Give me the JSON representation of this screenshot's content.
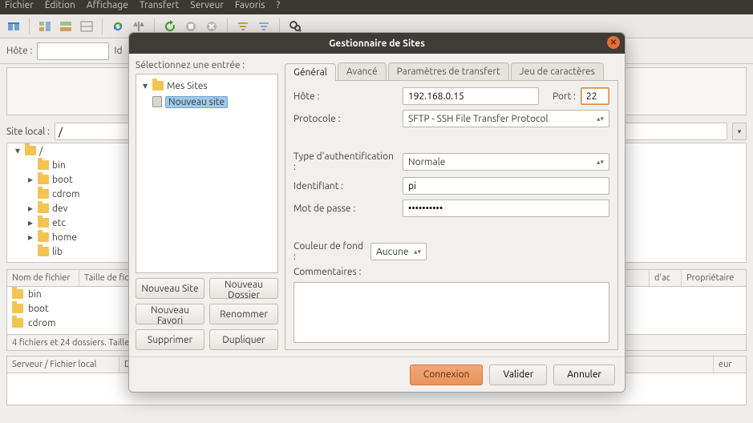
{
  "menubar": [
    "Fichier",
    "Édition",
    "Affichage",
    "Transfert",
    "Serveur",
    "Favoris",
    "?"
  ],
  "quick": {
    "host_label": "Hôte :",
    "user_label": "Id"
  },
  "local": {
    "label": "Site local :",
    "path": "/",
    "tree": [
      {
        "name": "/",
        "depth": 0,
        "expander": "▾"
      },
      {
        "name": "bin",
        "depth": 1,
        "expander": ""
      },
      {
        "name": "boot",
        "depth": 1,
        "expander": "▸"
      },
      {
        "name": "cdrom",
        "depth": 1,
        "expander": ""
      },
      {
        "name": "dev",
        "depth": 1,
        "expander": "▸"
      },
      {
        "name": "etc",
        "depth": 1,
        "expander": "▸"
      },
      {
        "name": "home",
        "depth": 1,
        "expander": "▸"
      },
      {
        "name": "lib",
        "depth": 1,
        "expander": ""
      }
    ],
    "list_cols": {
      "name": "Nom de fichier",
      "size": "Taille de fic",
      "date": "d'ac",
      "owner": "Propriétaire"
    },
    "list_rows": [
      "bin",
      "boot",
      "cdrom"
    ],
    "status": "4 fichiers et 24 dossiers. Taille"
  },
  "queue": {
    "server": "Serveur / Fichier local",
    "dir": "D",
    "remote": "eur"
  },
  "dialog": {
    "title": "Gestionnaire de Sites",
    "select_caption": "Sélectionnez une entrée :",
    "tree": {
      "root": "Mes Sites",
      "entry": "Nouveau site"
    },
    "buttons": {
      "new_site": "Nouveau Site",
      "new_folder": "Nouveau Dossier",
      "new_favorite": "Nouveau Favori",
      "rename": "Renommer",
      "delete": "Supprimer",
      "duplicate": "Dupliquer"
    },
    "tabs": [
      "Général",
      "Avancé",
      "Paramètres de transfert",
      "Jeu de caractères"
    ],
    "form": {
      "host_label": "Hôte :",
      "host": "192.168.0.15",
      "port_label": "Port :",
      "port": "22",
      "protocol_label": "Protocole :",
      "protocol": "SFTP - SSH File Transfer Protocol",
      "auth_label": "Type d'authentification :",
      "auth": "Normale",
      "user_label": "Identifiant :",
      "user": "pi",
      "pass_label": "Mot de passe :",
      "pass": "••••••••••",
      "bg_label": "Couleur de fond :",
      "bg": "Aucune",
      "comment_label": "Commentaires :"
    },
    "footer": {
      "connect": "Connexion",
      "validate": "Valider",
      "cancel": "Annuler"
    }
  }
}
